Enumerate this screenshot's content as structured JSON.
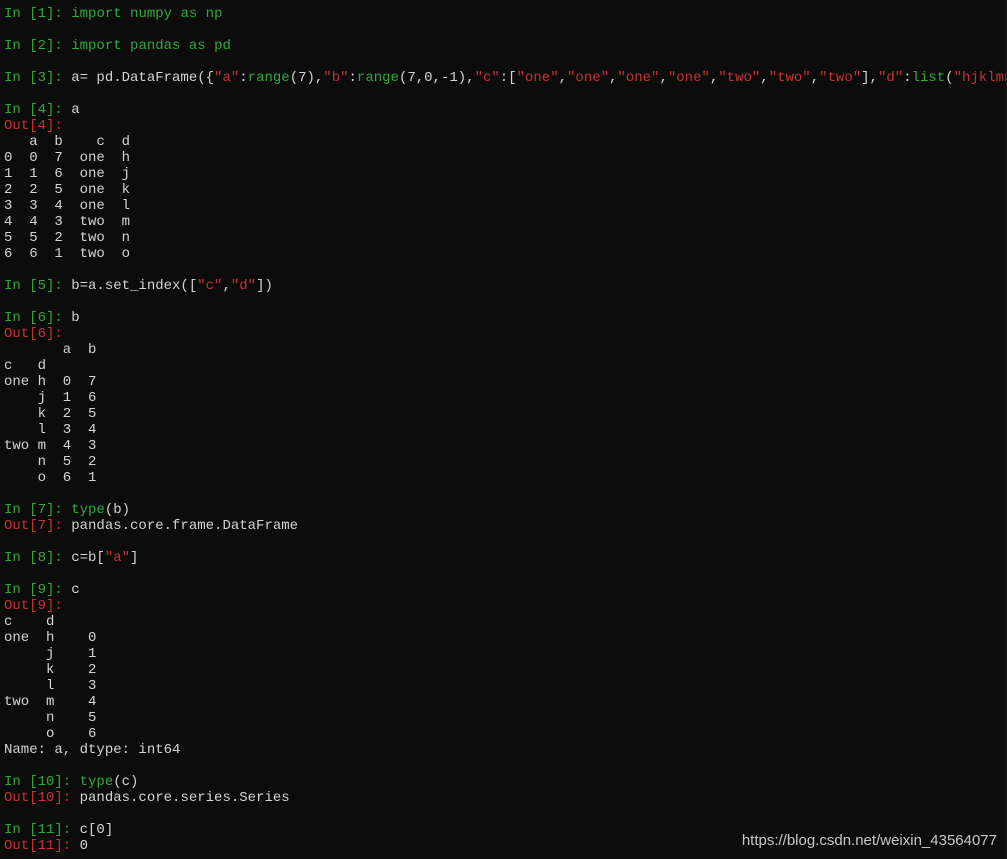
{
  "colors": {
    "background": "#0c0c0c",
    "text": "#d4d4d4",
    "in_prompt": "#2eaa3a",
    "out_prompt": "#c83232",
    "string": "#c83232"
  },
  "lines": [
    [
      {
        "t": "In [",
        "c": "in-prompt"
      },
      {
        "t": "1",
        "c": "in-prompt"
      },
      {
        "t": "]: ",
        "c": "in-prompt"
      },
      {
        "t": "import",
        "c": "kw"
      },
      {
        "t": " numpy ",
        "c": "kw"
      },
      {
        "t": "as",
        "c": "kw"
      },
      {
        "t": " np",
        "c": "kw"
      }
    ],
    [],
    [
      {
        "t": "In [2]: ",
        "c": "in-prompt"
      },
      {
        "t": "import",
        "c": "kw"
      },
      {
        "t": " pandas ",
        "c": "kw"
      },
      {
        "t": "as",
        "c": "kw"
      },
      {
        "t": " pd",
        "c": "kw"
      }
    ],
    [],
    [
      {
        "t": "In [3]: ",
        "c": "in-prompt"
      },
      {
        "t": "a= pd.DataFrame({",
        "c": "id"
      },
      {
        "t": "\"a\"",
        "c": "str"
      },
      {
        "t": ":",
        "c": "id"
      },
      {
        "t": "range",
        "c": "func"
      },
      {
        "t": "(7),",
        "c": "id"
      },
      {
        "t": "\"b\"",
        "c": "str"
      },
      {
        "t": ":",
        "c": "id"
      },
      {
        "t": "range",
        "c": "func"
      },
      {
        "t": "(7,0,-1),",
        "c": "id"
      },
      {
        "t": "\"c\"",
        "c": "str"
      },
      {
        "t": ":[",
        "c": "id"
      },
      {
        "t": "\"one\"",
        "c": "str"
      },
      {
        "t": ",",
        "c": "id"
      },
      {
        "t": "\"one\"",
        "c": "str"
      },
      {
        "t": ",",
        "c": "id"
      },
      {
        "t": "\"one\"",
        "c": "str"
      },
      {
        "t": ",",
        "c": "id"
      },
      {
        "t": "\"one\"",
        "c": "str"
      },
      {
        "t": ",",
        "c": "id"
      },
      {
        "t": "\"two\"",
        "c": "str"
      },
      {
        "t": ",",
        "c": "id"
      },
      {
        "t": "\"two\"",
        "c": "str"
      },
      {
        "t": ",",
        "c": "id"
      },
      {
        "t": "\"two\"",
        "c": "str"
      },
      {
        "t": "],",
        "c": "id"
      },
      {
        "t": "\"d\"",
        "c": "str"
      },
      {
        "t": ":",
        "c": "id"
      },
      {
        "t": "list",
        "c": "func"
      },
      {
        "t": "(",
        "c": "id"
      },
      {
        "t": "\"hjklmno\"",
        "c": "str"
      },
      {
        "t": ")})",
        "c": "id"
      }
    ],
    [],
    [
      {
        "t": "In [4]: ",
        "c": "in-prompt"
      },
      {
        "t": "a",
        "c": "id"
      }
    ],
    [
      {
        "t": "Out[4]:",
        "c": "out-prompt"
      }
    ],
    [
      {
        "t": "   a  b    c  d",
        "c": "id"
      }
    ],
    [
      {
        "t": "0  0  7  one  h",
        "c": "id"
      }
    ],
    [
      {
        "t": "1  1  6  one  j",
        "c": "id"
      }
    ],
    [
      {
        "t": "2  2  5  one  k",
        "c": "id"
      }
    ],
    [
      {
        "t": "3  3  4  one  l",
        "c": "id"
      }
    ],
    [
      {
        "t": "4  4  3  two  m",
        "c": "id"
      }
    ],
    [
      {
        "t": "5  5  2  two  n",
        "c": "id"
      }
    ],
    [
      {
        "t": "6  6  1  two  o",
        "c": "id"
      }
    ],
    [],
    [
      {
        "t": "In [5]: ",
        "c": "in-prompt"
      },
      {
        "t": "b=a.set_index([",
        "c": "id"
      },
      {
        "t": "\"c\"",
        "c": "str"
      },
      {
        "t": ",",
        "c": "id"
      },
      {
        "t": "\"d\"",
        "c": "str"
      },
      {
        "t": "])",
        "c": "id"
      }
    ],
    [],
    [
      {
        "t": "In [6]: ",
        "c": "in-prompt"
      },
      {
        "t": "b",
        "c": "id"
      }
    ],
    [
      {
        "t": "Out[6]:",
        "c": "out-prompt"
      }
    ],
    [
      {
        "t": "       a  b",
        "c": "id"
      }
    ],
    [
      {
        "t": "c   d",
        "c": "id"
      }
    ],
    [
      {
        "t": "one h  0  7",
        "c": "id"
      }
    ],
    [
      {
        "t": "    j  1  6",
        "c": "id"
      }
    ],
    [
      {
        "t": "    k  2  5",
        "c": "id"
      }
    ],
    [
      {
        "t": "    l  3  4",
        "c": "id"
      }
    ],
    [
      {
        "t": "two m  4  3",
        "c": "id"
      }
    ],
    [
      {
        "t": "    n  5  2",
        "c": "id"
      }
    ],
    [
      {
        "t": "    o  6  1",
        "c": "id"
      }
    ],
    [],
    [
      {
        "t": "In [7]: ",
        "c": "in-prompt"
      },
      {
        "t": "type",
        "c": "func"
      },
      {
        "t": "(b)",
        "c": "id"
      }
    ],
    [
      {
        "t": "Out[7]: ",
        "c": "out-prompt"
      },
      {
        "t": "pandas.core.frame.DataFrame",
        "c": "id"
      }
    ],
    [],
    [
      {
        "t": "In [8]: ",
        "c": "in-prompt"
      },
      {
        "t": "c=b[",
        "c": "id"
      },
      {
        "t": "\"a\"",
        "c": "str"
      },
      {
        "t": "]",
        "c": "id"
      }
    ],
    [],
    [
      {
        "t": "In [9]: ",
        "c": "in-prompt"
      },
      {
        "t": "c",
        "c": "id"
      }
    ],
    [
      {
        "t": "Out[9]:",
        "c": "out-prompt"
      }
    ],
    [
      {
        "t": "c    d",
        "c": "id"
      }
    ],
    [
      {
        "t": "one  h    0",
        "c": "id"
      }
    ],
    [
      {
        "t": "     j    1",
        "c": "id"
      }
    ],
    [
      {
        "t": "     k    2",
        "c": "id"
      }
    ],
    [
      {
        "t": "     l    3",
        "c": "id"
      }
    ],
    [
      {
        "t": "two  m    4",
        "c": "id"
      }
    ],
    [
      {
        "t": "     n    5",
        "c": "id"
      }
    ],
    [
      {
        "t": "     o    6",
        "c": "id"
      }
    ],
    [
      {
        "t": "Name: a, dtype: int64",
        "c": "id"
      }
    ],
    [],
    [
      {
        "t": "In [10]: ",
        "c": "in-prompt"
      },
      {
        "t": "type",
        "c": "func"
      },
      {
        "t": "(c)",
        "c": "id"
      }
    ],
    [
      {
        "t": "Out[10]: ",
        "c": "out-prompt"
      },
      {
        "t": "pandas.core.series.Series",
        "c": "id"
      }
    ],
    [],
    [
      {
        "t": "In [11]: ",
        "c": "in-prompt"
      },
      {
        "t": "c[0]",
        "c": "id"
      }
    ],
    [
      {
        "t": "Out[11]: ",
        "c": "out-prompt"
      },
      {
        "t": "0",
        "c": "id"
      }
    ]
  ],
  "watermark": "https://blog.csdn.net/weixin_43564077"
}
